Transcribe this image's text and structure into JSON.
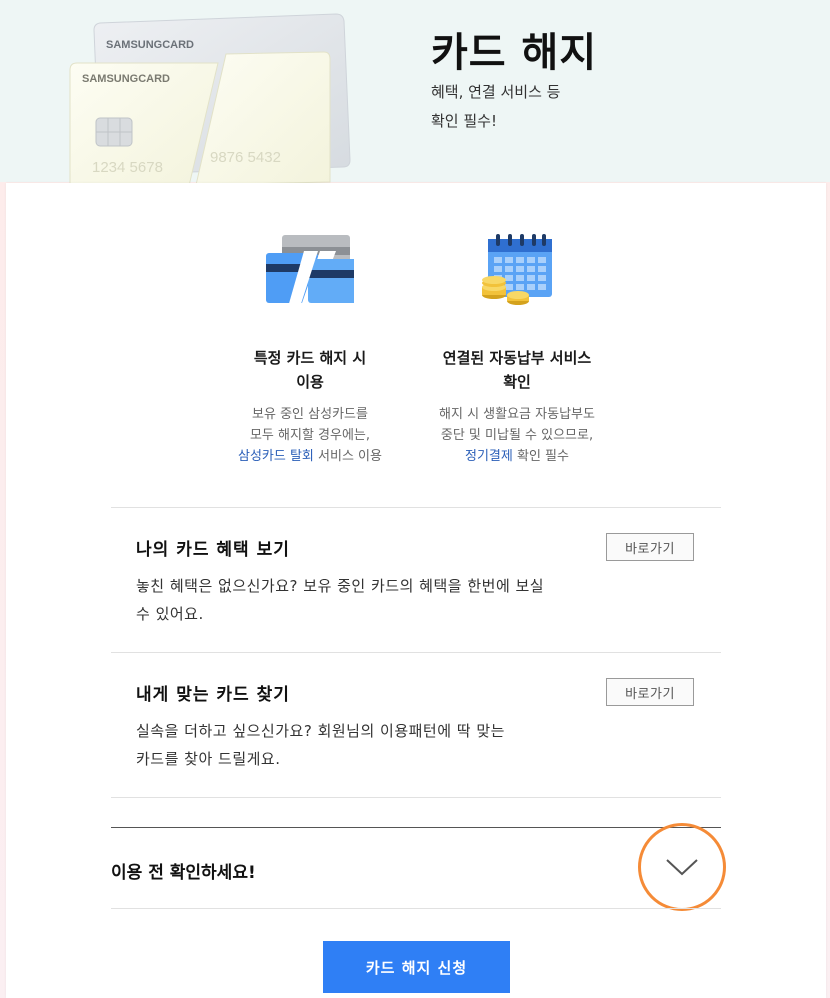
{
  "hero": {
    "card_brand_back": "SAMSUNGCARD",
    "card_brand_front": "SAMSUNGCARD",
    "card_number_front": "1234  5678",
    "card_number_back": "9876  5432",
    "title": "카드 해지",
    "subtitle_line1": "혜택, 연결 서비스 등",
    "subtitle_line2": "확인 필수!"
  },
  "features": [
    {
      "icon": "broken-card-icon",
      "title_line1": "특정 카드 해지 시",
      "title_line2": "이용",
      "desc_line1": "보유 중인 삼성카드를",
      "desc_line2": "모두 해지할 경우에는,",
      "desc_link": "삼성카드 탈회",
      "desc_line3_rest": " 서비스 이용"
    },
    {
      "icon": "calendar-coins-icon",
      "title_line1": "연결된 자동납부 서비스",
      "title_line2": "확인",
      "desc_line1": "해지 시 생활요금 자동납부도",
      "desc_line2": "중단 및 미납될 수 있으므로,",
      "desc_link": "정기결제",
      "desc_line3_rest": " 확인 필수"
    }
  ],
  "services": [
    {
      "title": "나의 카드 혜택 보기",
      "desc_line1": "놓친 혜택은 없으신가요? 보유 중인 카드의 혜택을 한번에 보실",
      "desc_line2": "수 있어요.",
      "button": "바로가기"
    },
    {
      "title": "내게 맞는 카드 찾기",
      "desc_line1": "실속을 더하고 싶으신가요? 회원님의 이용패턴에 딱 맞는",
      "desc_line2": "카드를 찾아 드릴게요.",
      "button": "바로가기"
    }
  ],
  "notice": {
    "title": "이용 전 확인하세요!",
    "toggle_icon": "chevron-down-icon"
  },
  "apply_button": "카드 해지 신청",
  "colors": {
    "primary": "#2f7ff5",
    "highlight_ring": "#f58b37",
    "link": "#2b5fb8"
  }
}
